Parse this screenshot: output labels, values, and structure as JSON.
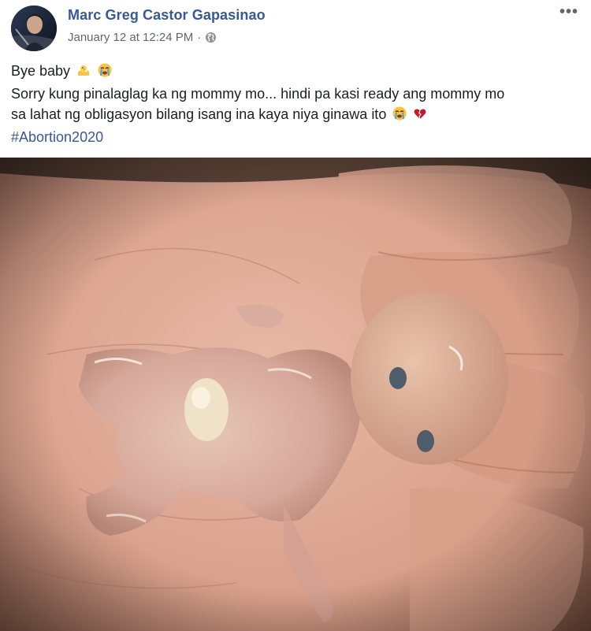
{
  "post": {
    "author": "Marc Greg Castor Gapasinao",
    "timestamp": "January 12 at 12:24 PM",
    "separator": "·",
    "privacy_icon": "globe-icon",
    "more_icon": "more-options-icon",
    "more_label": "•••",
    "lines": [
      "Bye baby",
      "Sorry kung pinalaglag ka ng mommy mo... hindi pa kasi ready ang mommy mo",
      "sa lahat ng obligasyon bilang isang ina kaya niya ginawa ito"
    ],
    "hashtag": "#Abortion2020",
    "emoji": [
      "baby-chick-emoji",
      "loudly-crying-face-emoji",
      "broken-heart-emoji"
    ]
  },
  "colors": {
    "link": "#385898",
    "meta": "#616770",
    "text": "#1c1e21"
  }
}
